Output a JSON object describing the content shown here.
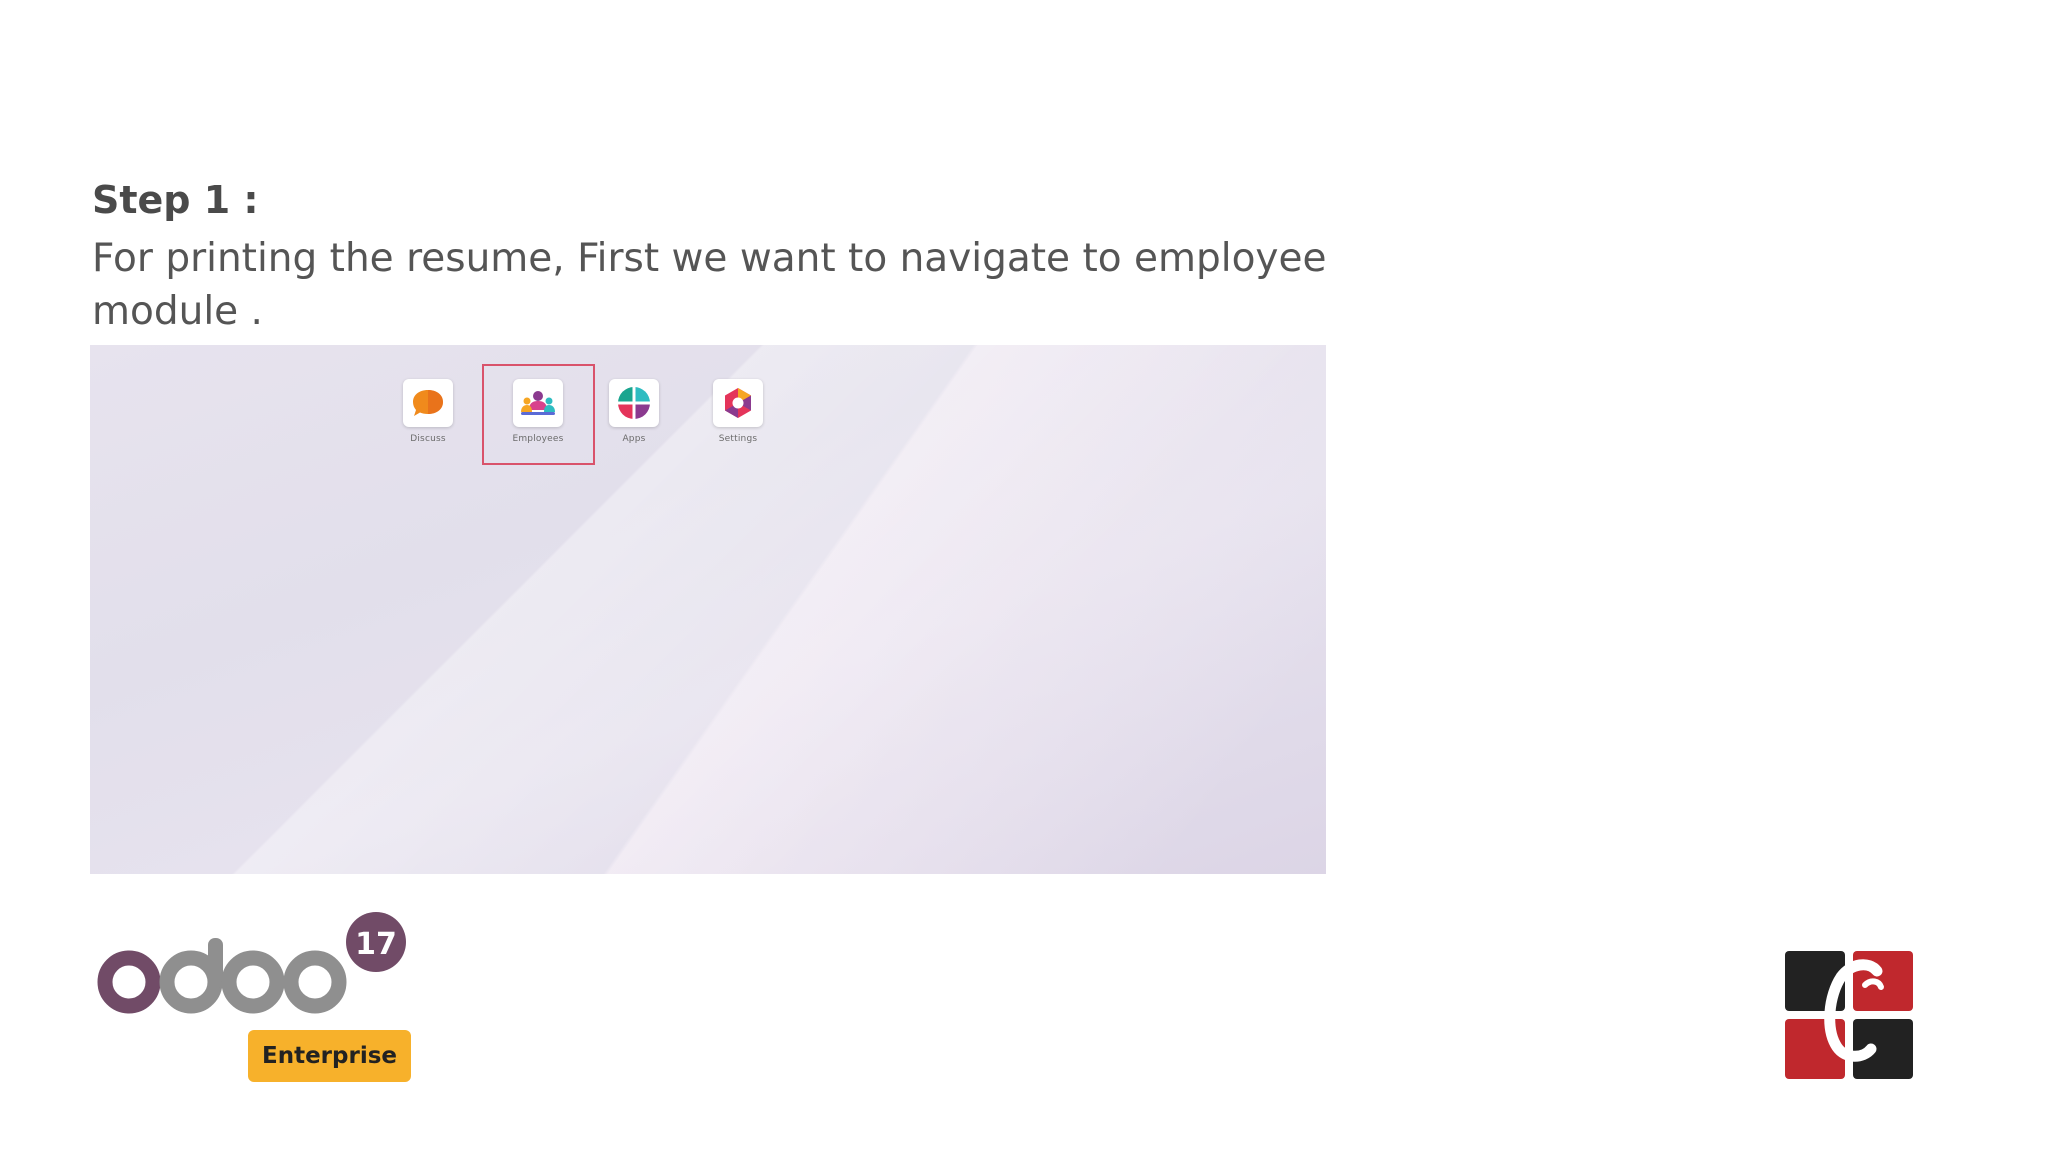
{
  "step": {
    "heading": "Step 1 :",
    "text": "For printing the resume, First we want to navigate to employee module ."
  },
  "screenshot": {
    "apps": [
      {
        "label": "Discuss",
        "icon": "discuss-icon"
      },
      {
        "label": "Employees",
        "icon": "employees-icon",
        "highlighted": true
      },
      {
        "label": "Apps",
        "icon": "apps-icon"
      },
      {
        "label": "Settings",
        "icon": "settings-icon"
      }
    ],
    "highlight_color": "#d9536b"
  },
  "branding": {
    "odoo_version_badge": "17",
    "edition_badge": "Enterprise",
    "odoo_purple": "#714b67",
    "odoo_grey": "#8f8f8f",
    "enterprise_color": "#f7b12b",
    "company_logo": "cybrosys-logo"
  }
}
